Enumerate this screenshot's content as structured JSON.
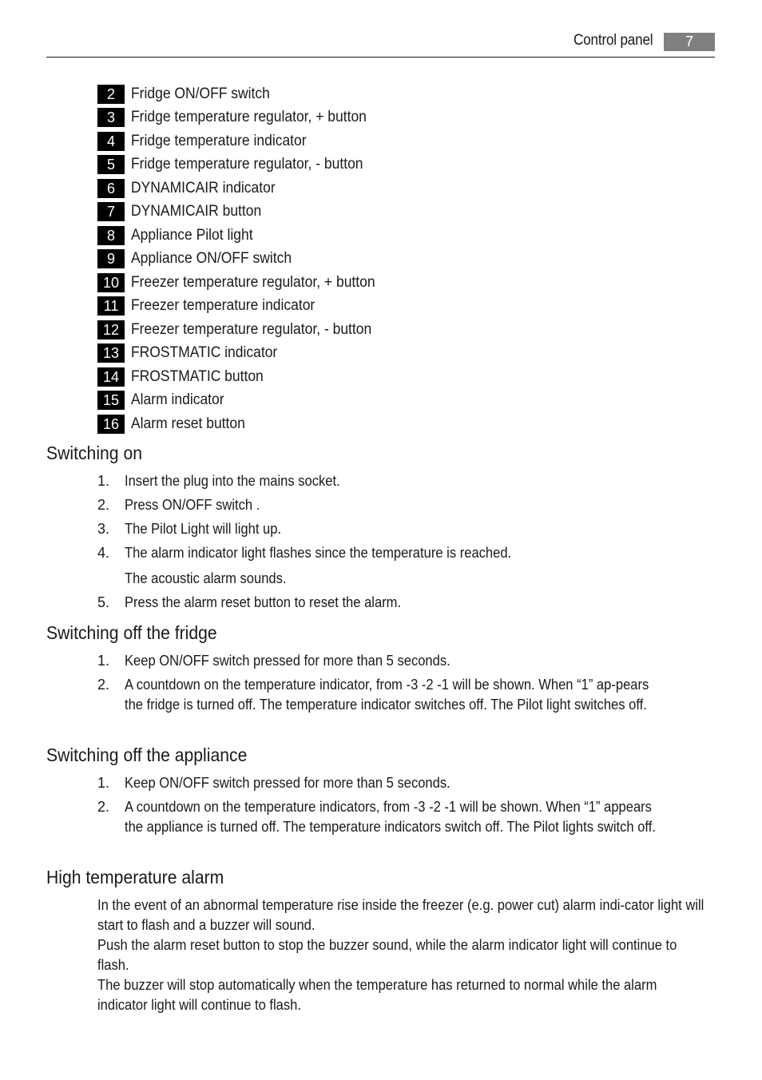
{
  "header": {
    "title": "Control panel",
    "page_number": "7"
  },
  "legend": [
    {
      "num": "2",
      "label": "Fridge ON/OFF switch"
    },
    {
      "num": "3",
      "label": "Fridge temperature regulator, + button"
    },
    {
      "num": "4",
      "label": "Fridge temperature indicator"
    },
    {
      "num": "5",
      "label": "Fridge temperature regulator, - button"
    },
    {
      "num": "6",
      "label": "DYNAMICAIR indicator"
    },
    {
      "num": "7",
      "label": "DYNAMICAIR button"
    },
    {
      "num": "8",
      "label": "Appliance Pilot light"
    },
    {
      "num": "9",
      "label": "Appliance ON/OFF switch"
    },
    {
      "num": "10",
      "label": "Freezer temperature regulator, + button"
    },
    {
      "num": "11",
      "label": "Freezer temperature indicator"
    },
    {
      "num": "12",
      "label": "Freezer temperature regulator, - button"
    },
    {
      "num": "13",
      "label": "FROSTMATIC indicator"
    },
    {
      "num": "14",
      "label": "FROSTMATIC button"
    },
    {
      "num": "15",
      "label": "Alarm indicator"
    },
    {
      "num": "16",
      "label": "Alarm reset button"
    }
  ],
  "sections": {
    "switching_on": {
      "title": "Switching on",
      "steps": [
        {
          "num": "1.",
          "text": "Insert the plug into the mains socket."
        },
        {
          "num": "2.",
          "text": "Press ON/OFF switch ."
        },
        {
          "num": "3.",
          "text": "The Pilot Light will light up."
        },
        {
          "num": "4.",
          "text": "The alarm indicator light flashes since the temperature is reached.",
          "extra": "The acoustic alarm sounds."
        },
        {
          "num": "5.",
          "text": "Press the alarm reset button to reset the alarm."
        }
      ]
    },
    "switching_off_fridge": {
      "title": "Switching off the fridge",
      "steps": [
        {
          "num": "1.",
          "text": "Keep ON/OFF switch pressed for more than 5 seconds."
        },
        {
          "num": "2.",
          "text": "A countdown on the temperature indicator, from -3 -2 -1 will be shown. When “1” ap-pears the fridge is turned off. The temperature indicator switches off. The Pilot light switches off."
        }
      ]
    },
    "switching_off_appliance": {
      "title": "Switching off the appliance",
      "steps": [
        {
          "num": "1.",
          "text": "Keep ON/OFF switch pressed for more than 5 seconds."
        },
        {
          "num": "2.",
          "text": "A countdown on the temperature indicators, from -3 -2 -1 will be shown. When “1” appears the appliance is turned off. The temperature indicators switch off. The Pilot lights switch off."
        }
      ]
    },
    "high_temperature_alarm": {
      "title": "High temperature alarm",
      "paragraphs": [
        "In the event of an abnormal temperature rise inside the freezer (e.g. power cut) alarm indi-cator light will start to flash and a buzzer will sound.",
        "Push the alarm reset button to stop the buzzer sound, while the alarm indicator light will continue to flash.",
        "The buzzer will stop automatically when the temperature has returned to normal while the alarm indicator light will continue to flash."
      ]
    }
  }
}
